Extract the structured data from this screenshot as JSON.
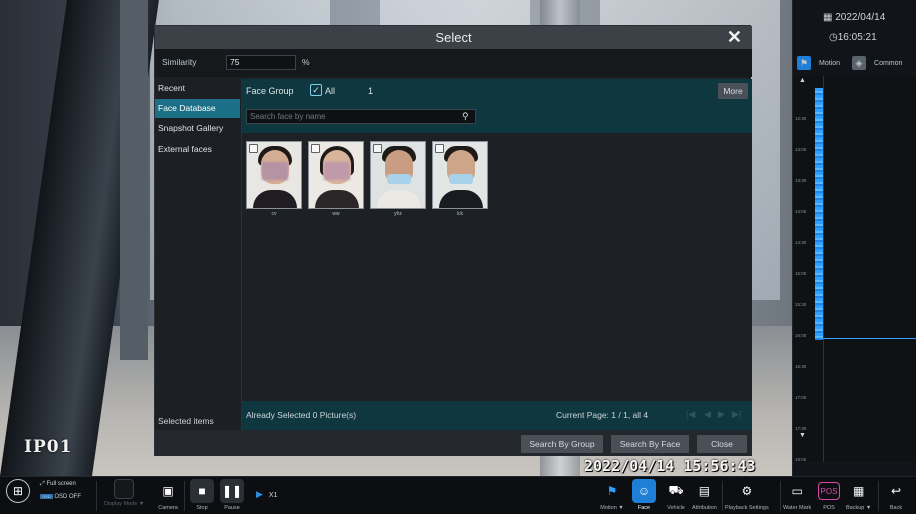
{
  "camera": {
    "label": "IP01",
    "osd_time": "2022/04/14 15:56:43"
  },
  "right_panel": {
    "date": "2022/04/14",
    "time": "16:05:21",
    "modes": [
      "Motion",
      "Common"
    ],
    "timeline_ticks": [
      "12:30",
      "13:00",
      "13:30",
      "14:00",
      "14:30",
      "15:00",
      "15:30",
      "16:00",
      "16:30",
      "17:00",
      "17:30",
      "18:00"
    ]
  },
  "dialog": {
    "title": "Select",
    "similarity_label": "Similarity",
    "similarity_value": "75",
    "similarity_unit": "%",
    "nav": [
      "Recent",
      "Face Database",
      "Snapshot Gallery",
      "External faces"
    ],
    "nav_active": "Face Database",
    "selected_items_label": "Selected items",
    "face_group_label": "Face Group",
    "all_label": "All",
    "group_count": "1",
    "more_label": "More",
    "search_placeholder": "Search face by name",
    "faces": [
      {
        "name": "cv"
      },
      {
        "name": "ww"
      },
      {
        "name": "yhz"
      },
      {
        "name": "lck"
      }
    ],
    "already_selected": "Already Selected 0 Picture(s)",
    "current_page": "Current Page: 1 / 1, all 4",
    "buttons": {
      "search_by_group": "Search By Group",
      "search_by_face": "Search By Face",
      "close": "Close"
    }
  },
  "toolbar": {
    "full_screen": "Full screen",
    "osd_off": "OSD OFF",
    "display_mode": "Display Mode",
    "camera": "Camera",
    "stop": "Stop",
    "pause": "Pause",
    "speed": "X1",
    "motion": "Motion",
    "face": "Face",
    "vehicle": "Vehicle",
    "attribution": "Attribution",
    "playback_settings": "Playback Settings",
    "water_mark": "Water Mark",
    "pos": "POS",
    "pos_icon_text": "POS",
    "backup": "Backup",
    "back": "Back"
  }
}
